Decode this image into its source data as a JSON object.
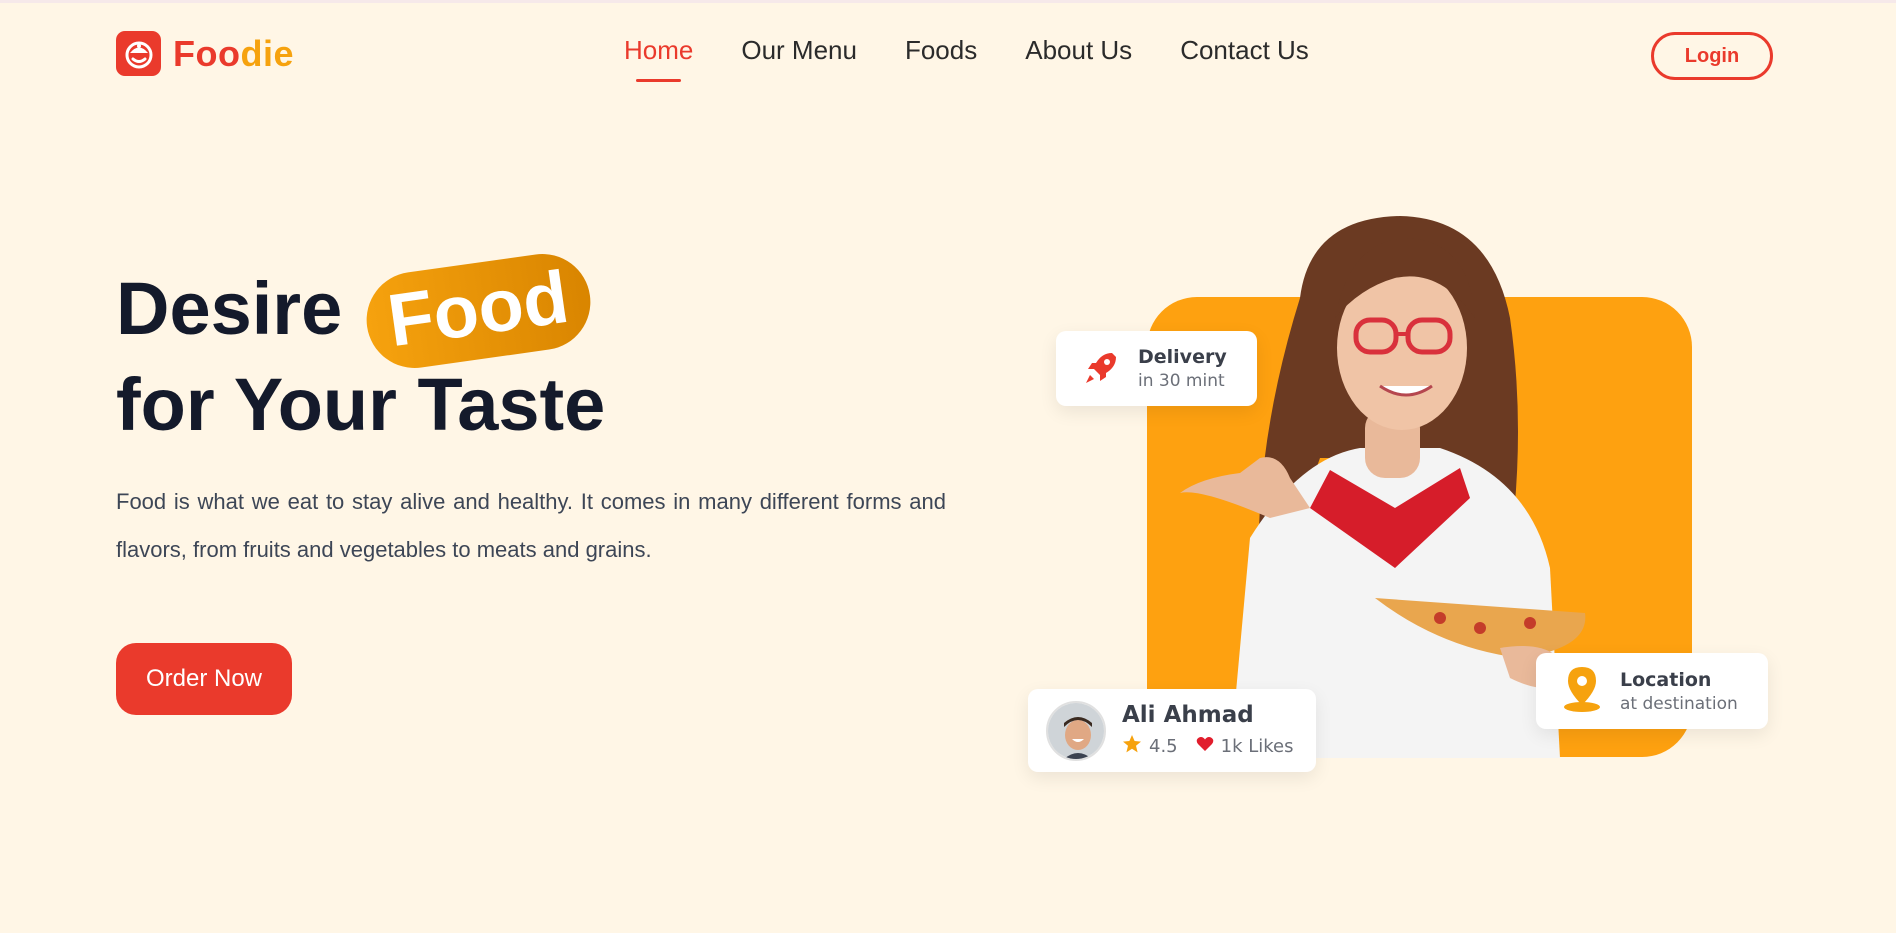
{
  "brand": {
    "part1": "Foo",
    "part2": "die",
    "accent": "#ea3a2c",
    "secondary": "#f6a20e",
    "background": "#fff6e6"
  },
  "nav": {
    "items": [
      {
        "label": "Home",
        "active": true
      },
      {
        "label": "Our Menu",
        "active": false
      },
      {
        "label": "Foods",
        "active": false
      },
      {
        "label": "About Us",
        "active": false
      },
      {
        "label": "Contact Us",
        "active": false
      }
    ],
    "login_label": "Login"
  },
  "hero": {
    "title_start": "Desire",
    "title_highlight": "Food",
    "title_line2": "for Your Taste",
    "description": "Food is what we eat to stay alive and healthy. It comes in many different forms and flavors, from fruits and vegetables to meats and grains.",
    "cta_label": "Order Now"
  },
  "cards": {
    "delivery": {
      "title": "Delivery",
      "subtitle": "in 30 mint",
      "icon": "rocket-icon"
    },
    "location": {
      "title": "Location",
      "subtitle": "at destination",
      "icon": "map-pin-icon"
    },
    "user": {
      "name": "Ali Ahmad",
      "rating": "4.5",
      "likes": "1k Likes",
      "rating_icon": "star-icon",
      "likes_icon": "heart-icon"
    }
  }
}
